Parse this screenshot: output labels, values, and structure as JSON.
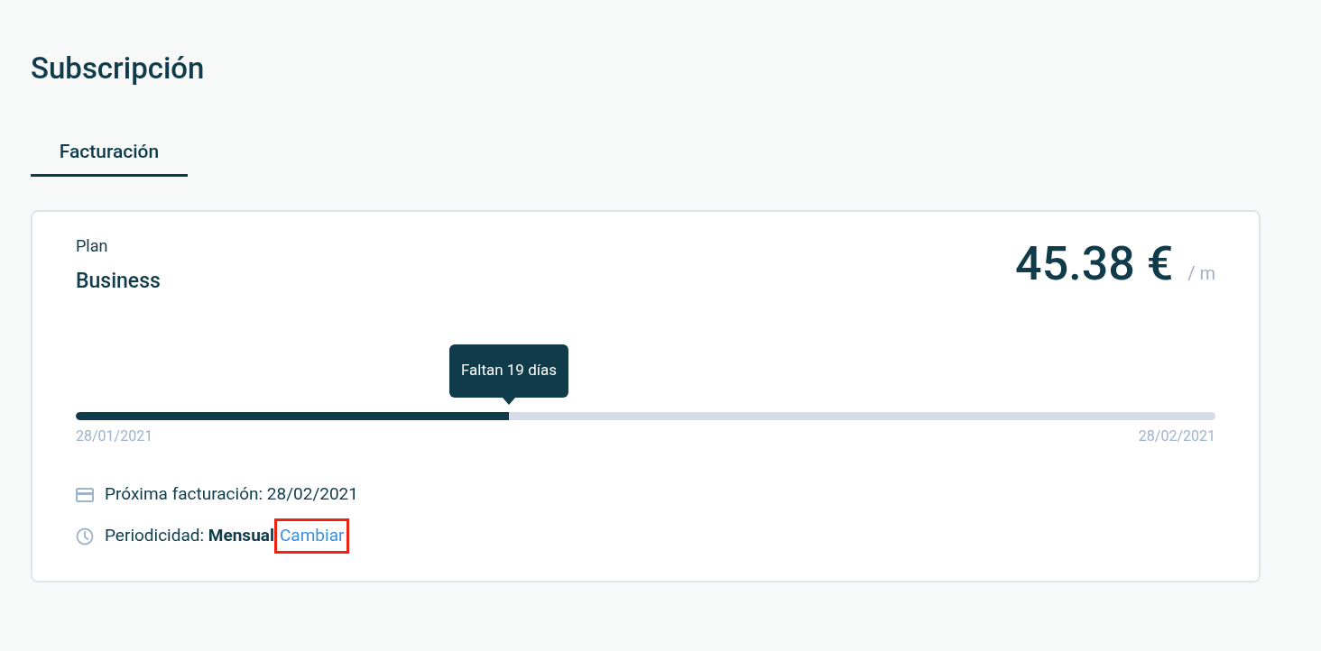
{
  "page": {
    "title": "Subscripción"
  },
  "tabs": [
    {
      "label": "Facturación",
      "selected": true
    }
  ],
  "plan": {
    "label": "Plan",
    "name": "Business",
    "price": "45.38 €",
    "period": "/ m"
  },
  "progress": {
    "level": 0.38,
    "tooltip": "Faltan 19 días",
    "start": "28/01/2021",
    "end": "28/02/2021"
  },
  "details": [
    {
      "kind": "card",
      "text": "Próxima facturación: 28/02/2021"
    },
    {
      "kind": "clock",
      "text": "Periodicidad: **Mensual**",
      "link": {
        "label": "Cambiar",
        "highlighted": true
      }
    }
  ]
}
